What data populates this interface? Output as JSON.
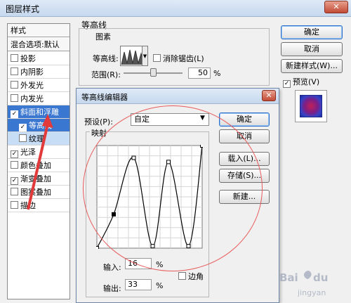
{
  "window": {
    "title": "图层样式",
    "close_glyph": "✕"
  },
  "styles_panel": {
    "items": [
      {
        "label": "样式",
        "checked": false,
        "kind": "header"
      },
      {
        "label": "混合选项:默认",
        "checked": false,
        "kind": "header"
      },
      {
        "label": "投影",
        "checked": false,
        "kind": "item"
      },
      {
        "label": "内阴影",
        "checked": false,
        "kind": "item"
      },
      {
        "label": "外发光",
        "checked": false,
        "kind": "item"
      },
      {
        "label": "内发光",
        "checked": false,
        "kind": "item"
      },
      {
        "label": "斜面和浮雕",
        "checked": true,
        "kind": "selected"
      },
      {
        "label": "等高线",
        "checked": true,
        "kind": "sub-selected"
      },
      {
        "label": "纹理",
        "checked": false,
        "kind": "sub"
      },
      {
        "label": "光泽",
        "checked": true,
        "kind": "item"
      },
      {
        "label": "颜色叠加",
        "checked": false,
        "kind": "item"
      },
      {
        "label": "渐变叠加",
        "checked": true,
        "kind": "item"
      },
      {
        "label": "图案叠加",
        "checked": false,
        "kind": "item"
      },
      {
        "label": "描边",
        "checked": false,
        "kind": "item"
      }
    ]
  },
  "contour_section": {
    "title": "等高线",
    "group_label": "图素",
    "contour_label": "等高线:",
    "antialias_label": "消除锯齿(L)",
    "range_label": "范围(R):",
    "range_value": "50",
    "range_unit": "%",
    "range_fraction": 0.5
  },
  "main_buttons": {
    "ok": "确定",
    "cancel": "取消",
    "new_style": "新建样式(W)...",
    "preview": "预览(V)"
  },
  "editor": {
    "title": "等高线编辑器",
    "close_glyph": "✕",
    "preset_label": "预设(P):",
    "preset_value": "自定",
    "mapping_label": "映射",
    "input_label": "输入:",
    "input_value": "16",
    "output_label": "输出:",
    "output_value": "33",
    "percent": "%",
    "corner_label": "边角",
    "buttons": {
      "ok": "确定",
      "cancel": "取消",
      "load": "载入(L)...",
      "save": "存储(S)...",
      "new": "新建..."
    },
    "curve_points": [
      [
        0,
        0
      ],
      [
        16,
        33
      ],
      [
        35,
        88
      ],
      [
        53,
        2
      ],
      [
        68,
        84
      ],
      [
        87,
        2
      ],
      [
        100,
        100
      ]
    ]
  },
  "watermark": "Baidu 经验"
}
